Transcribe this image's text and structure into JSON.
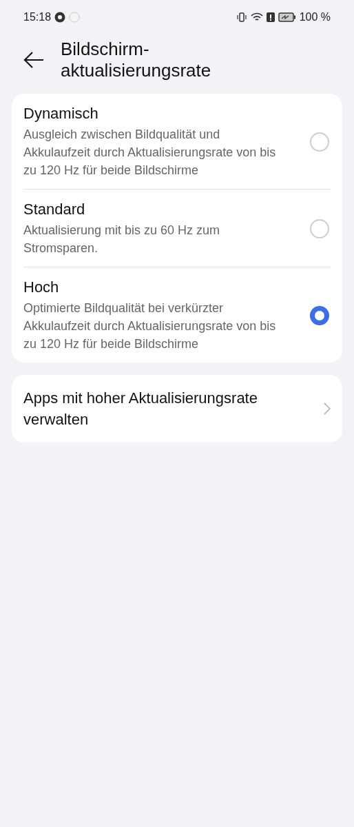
{
  "status_bar": {
    "time": "15:18",
    "battery": "100 %"
  },
  "header": {
    "title": "Bildschirm-\naktualisierungsrate"
  },
  "options": [
    {
      "label": "Dynamisch",
      "description": "Ausgleich zwischen Bildqualität und Akkulaufzeit durch Aktualisierungsrate von bis zu 120 Hz für beide Bildschirme",
      "selected": false
    },
    {
      "label": "Standard",
      "description": "Aktualisierung mit bis zu 60 Hz zum Stromsparen.",
      "selected": false
    },
    {
      "label": "Hoch",
      "description": "Optimierte Bildqualität bei verkürzter Akkulaufzeit durch Aktualisierungsrate von bis zu 120 Hz für beide Bildschirme",
      "selected": true
    }
  ],
  "link_item": {
    "label": "Apps mit hoher Aktualisierungsrate verwalten"
  }
}
